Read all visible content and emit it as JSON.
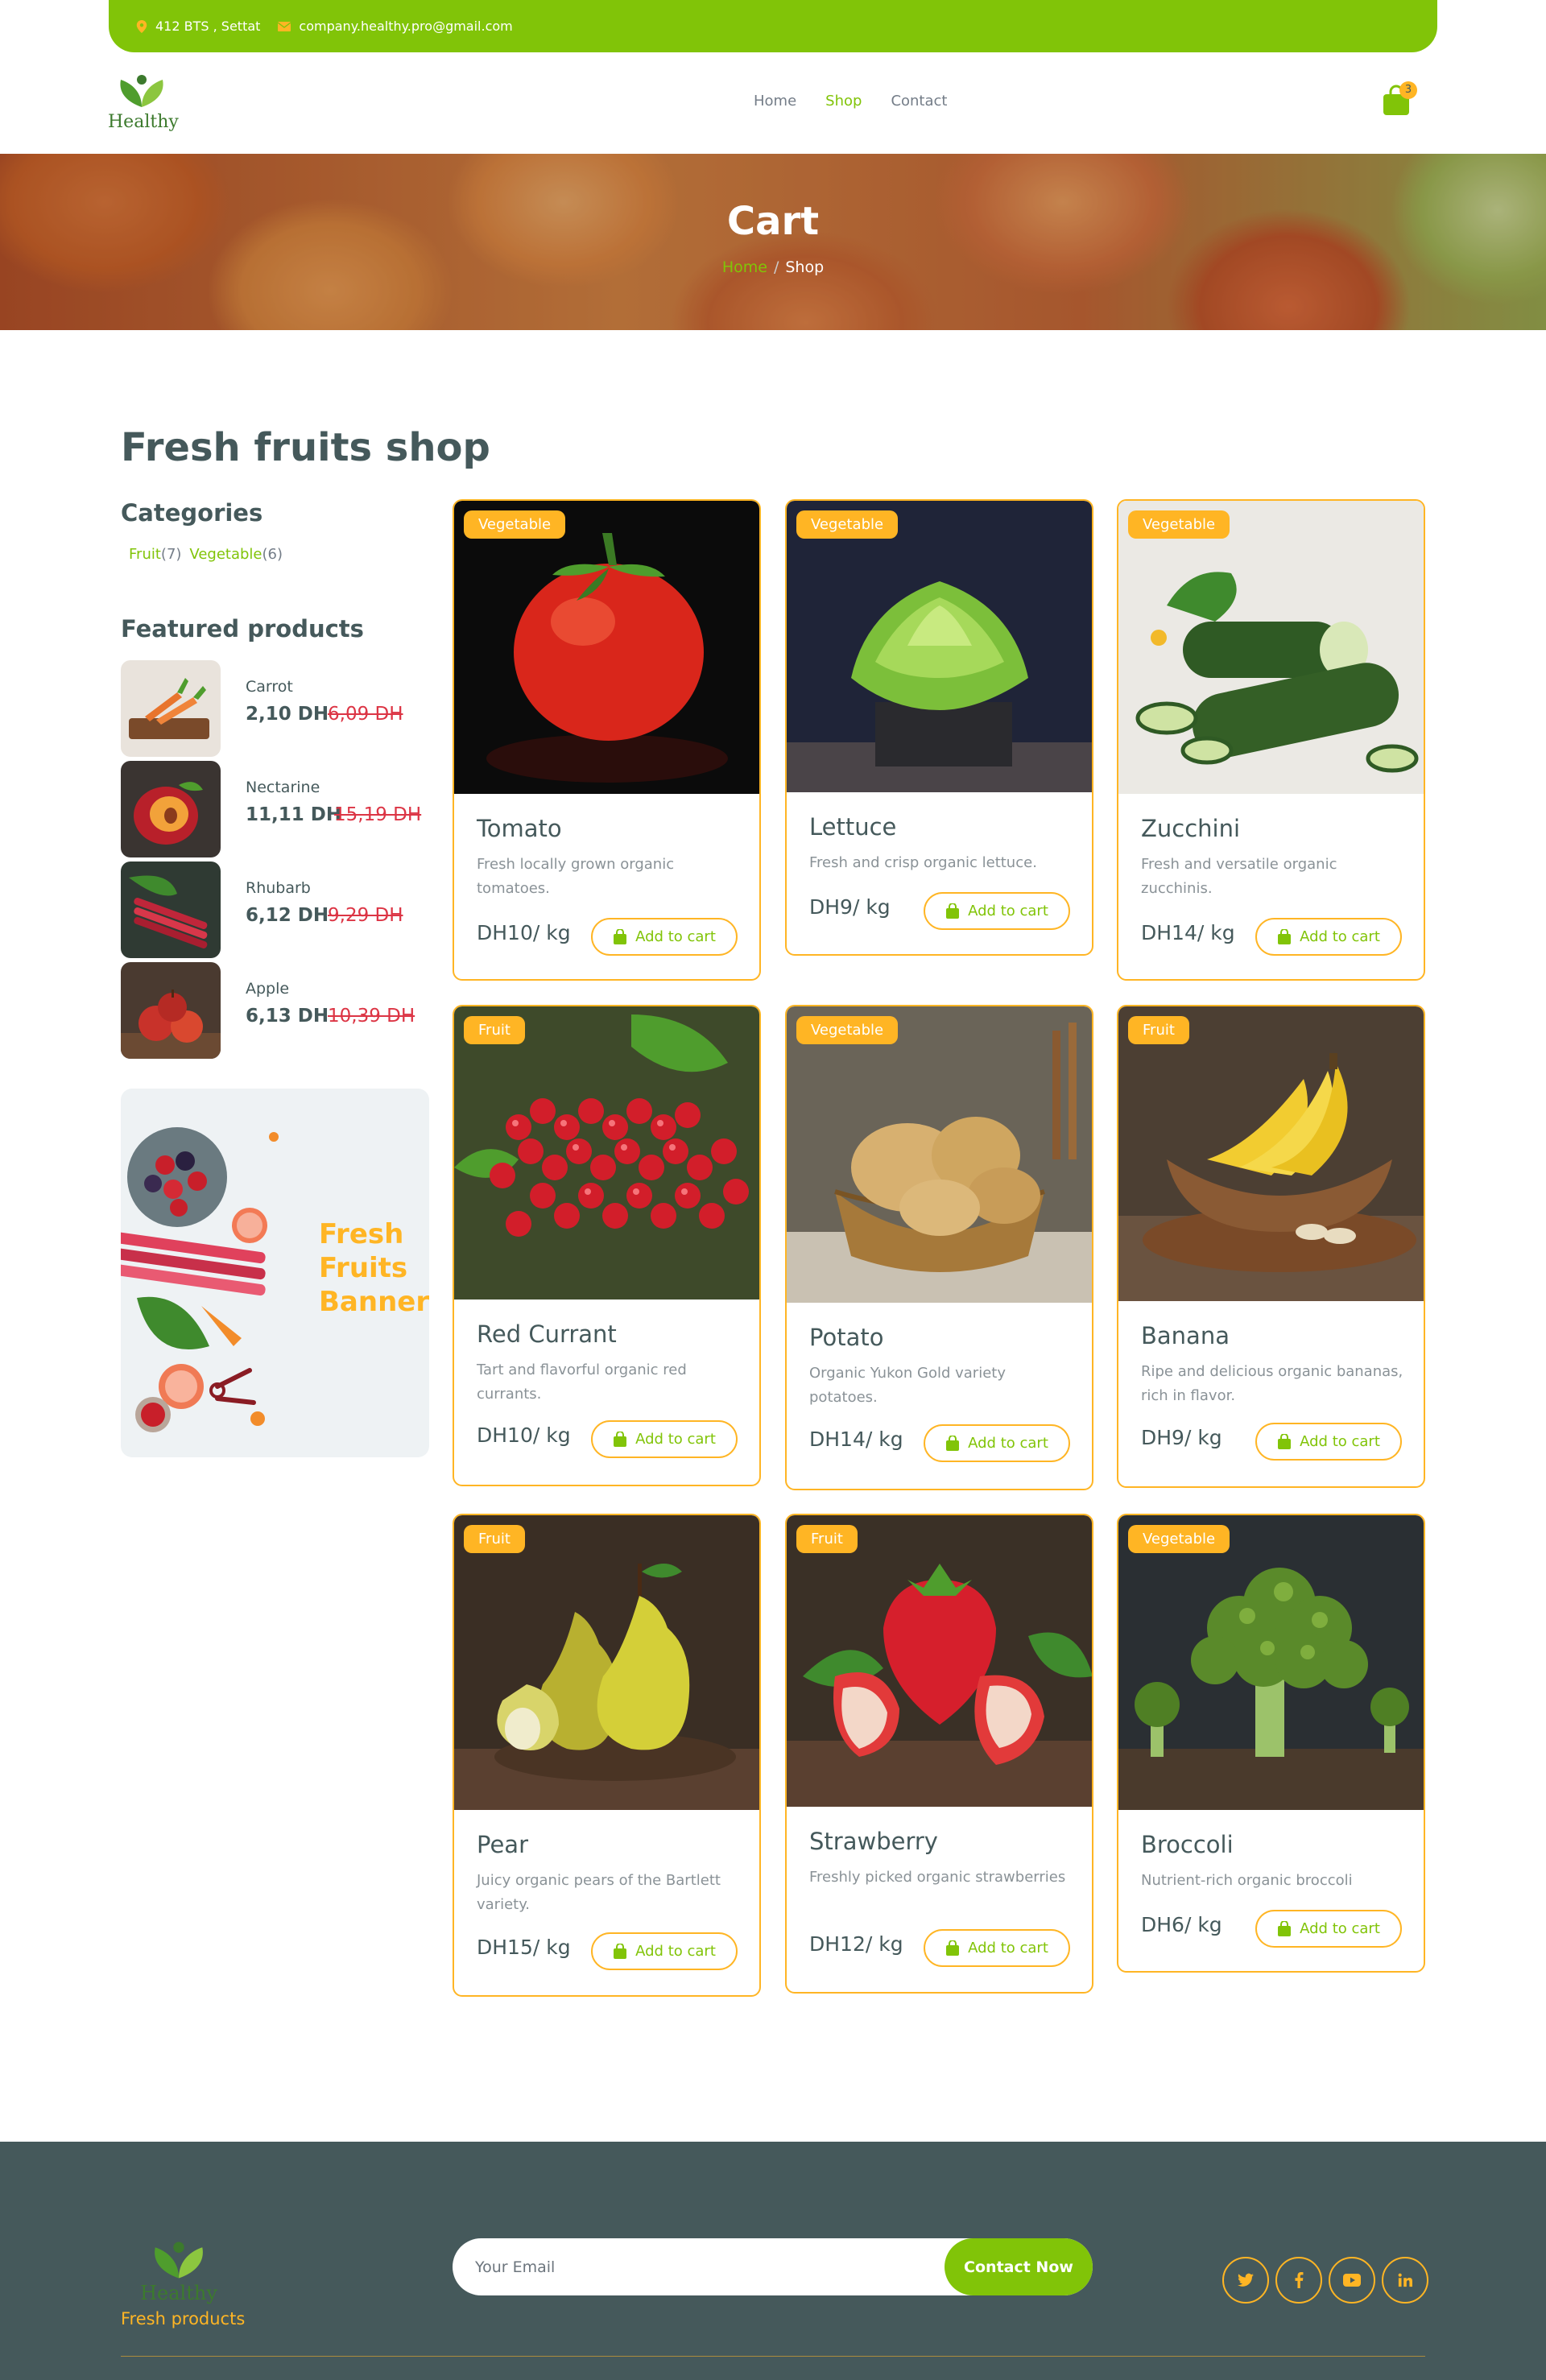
{
  "topbar": {
    "address": "412 BTS , Settat",
    "email": "company.healthy.pro@gmail.com",
    "address_icon": "map-pin-icon",
    "email_icon": "envelope-icon",
    "color": "#81c408"
  },
  "header": {
    "logo_text": "Healthy",
    "nav": [
      {
        "label": "Home",
        "active": false
      },
      {
        "label": "Shop",
        "active": true
      },
      {
        "label": "Contact",
        "active": false
      }
    ],
    "cart_count": "3"
  },
  "hero": {
    "title": "Cart",
    "breadcrumb_home": "Home",
    "breadcrumb_sep": "/",
    "breadcrumb_current": "Shop"
  },
  "shop": {
    "title": "Fresh fruits shop",
    "categories_title": "Categories",
    "categories": [
      {
        "label": "Fruit",
        "count": "(7)"
      },
      {
        "label": "Vegetable",
        "count": "(6)"
      }
    ],
    "featured_title": "Featured products",
    "featured": [
      {
        "name": "Carrot",
        "price": "2,10 DH",
        "old_price": "6,09 DH"
      },
      {
        "name": "Nectarine",
        "price": "11,11 DH",
        "old_price": "15,19 DH"
      },
      {
        "name": "Rhubarb",
        "price": "6,12 DH",
        "old_price": "9,29 DH"
      },
      {
        "name": "Apple",
        "price": "6,13 DH",
        "old_price": "10,39 DH"
      }
    ],
    "banner_text": [
      "Fresh",
      "Fruits",
      "Banner"
    ]
  },
  "products": [
    {
      "tag": "Vegetable",
      "title": "Tomato",
      "desc": "Fresh locally grown organic tomatoes.",
      "price": "DH10/ kg",
      "button": "Add to cart"
    },
    {
      "tag": "Vegetable",
      "title": "Lettuce",
      "desc": "Fresh and crisp organic lettuce.",
      "price": "DH9/ kg",
      "button": "Add to cart"
    },
    {
      "tag": "Vegetable",
      "title": "Zucchini",
      "desc": "Fresh and versatile organic zucchinis.",
      "price": "DH14/ kg",
      "button": "Add to cart"
    },
    {
      "tag": "Fruit",
      "title": "Red Currant",
      "desc": "Tart and flavorful organic red currants.",
      "price": "DH10/ kg",
      "button": "Add to cart"
    },
    {
      "tag": "Vegetable",
      "title": "Potato",
      "desc": "Organic Yukon Gold variety potatoes.",
      "price": "DH14/ kg",
      "button": "Add to cart"
    },
    {
      "tag": "Fruit",
      "title": "Banana",
      "desc": "Ripe and delicious organic bananas, rich in flavor.",
      "price": "DH9/ kg",
      "button": "Add to cart"
    },
    {
      "tag": "Fruit",
      "title": "Pear",
      "desc": "Juicy organic pears of the Bartlett variety.",
      "price": "DH15/ kg",
      "button": "Add to cart"
    },
    {
      "tag": "Fruit",
      "title": "Strawberry",
      "desc": "Freshly picked organic strawberries",
      "price": "DH12/ kg",
      "button": "Add to cart"
    },
    {
      "tag": "Vegetable",
      "title": "Broccoli",
      "desc": "Nutrient-rich organic broccoli",
      "price": "DH6/ kg",
      "button": "Add to cart"
    }
  ],
  "footer": {
    "logo_text": "Healthy",
    "tagline": "Fresh products",
    "email_placeholder": "Your Email",
    "contact_button": "Contact Now",
    "socials": [
      "twitter-icon",
      "facebook-icon",
      "youtube-icon",
      "linkedin-icon"
    ]
  },
  "colors": {
    "primary": "#81c408",
    "secondary": "#ffb524",
    "dark": "#45595b",
    "danger": "#dc3545"
  }
}
